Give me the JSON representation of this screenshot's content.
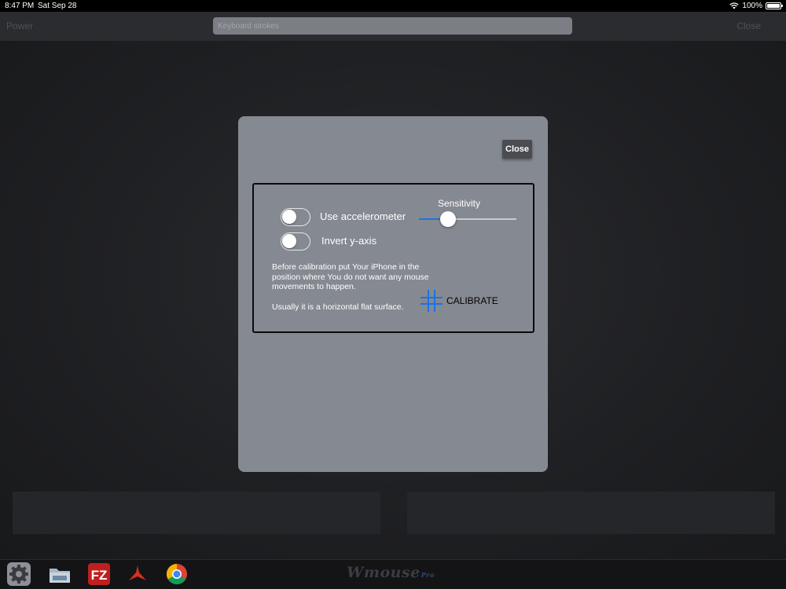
{
  "status_bar": {
    "time": "8:47 PM",
    "date": "Sat Sep 28",
    "battery": "100%"
  },
  "top_bar": {
    "left_label": "Power",
    "input_placeholder": "Keyboard strokes",
    "right_label": "Close"
  },
  "modal": {
    "close_label": "Close",
    "use_accelerometer": {
      "label": "Use accelerometer",
      "on": false
    },
    "invert_y_axis": {
      "label": "Invert y-axis",
      "on": false
    },
    "sensitivity": {
      "label": "Sensitivity",
      "value": 0.3
    },
    "calibration_text": "Before calibration put Your iPhone in the position where You do not want any mouse movements to happen.",
    "surface_text": "Usually it is a horizontal flat surface.",
    "calibrate_label": "CALIBRATE",
    "accent_color": "#1a73e8"
  },
  "dock": {
    "icons": [
      "gear-icon",
      "folder-icon",
      "filezilla-icon",
      "acrobat-icon",
      "chrome-icon"
    ],
    "logo": "Wmouse",
    "logo_sub": "Pro"
  }
}
